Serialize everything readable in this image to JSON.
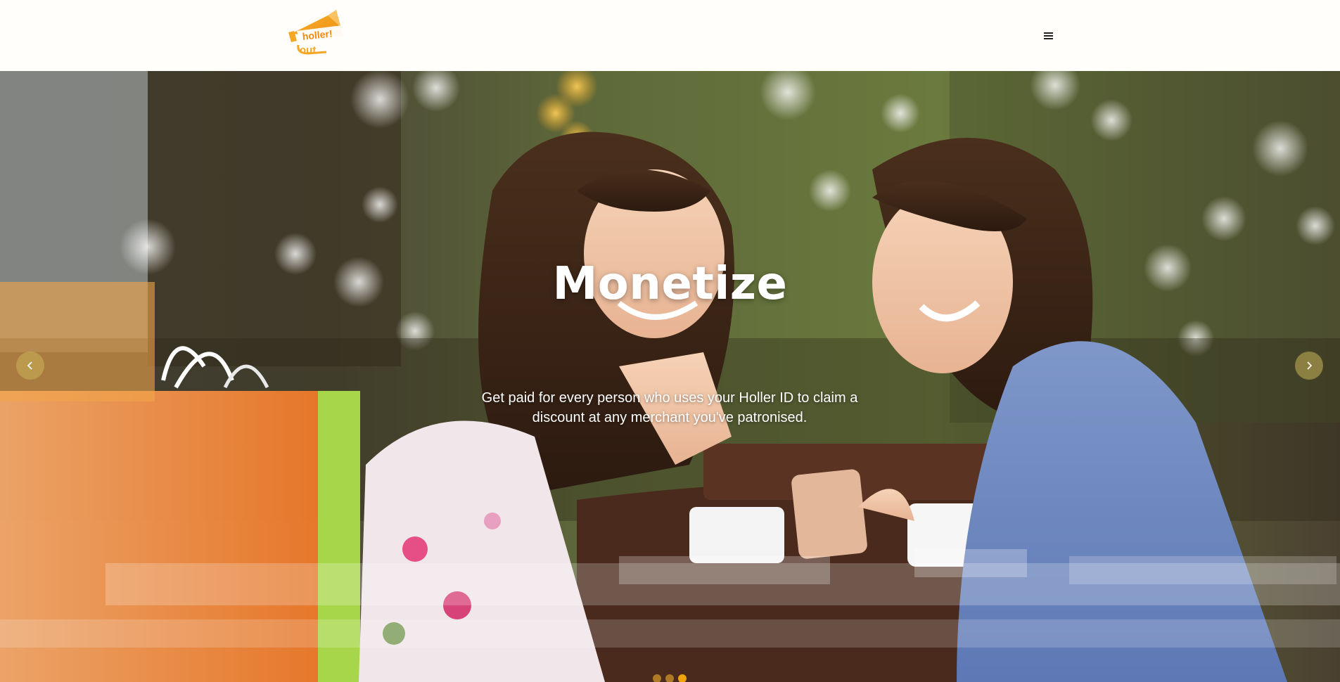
{
  "header": {
    "logo_text": "holler! out",
    "menu_icon": "hamburger-menu-icon"
  },
  "hero": {
    "title": "Monetize",
    "text": "Get paid for every person who uses your Holler ID to claim a discount at any merchant you've patronised.",
    "prev_icon": "chevron-left-icon",
    "next_icon": "chevron-right-icon",
    "slides": [
      {
        "active": false
      },
      {
        "active": false
      },
      {
        "active": true
      }
    ]
  },
  "colors": {
    "accent": "#f0a30a",
    "header_bg": "#fffefa",
    "hero_text": "#ffffff"
  }
}
